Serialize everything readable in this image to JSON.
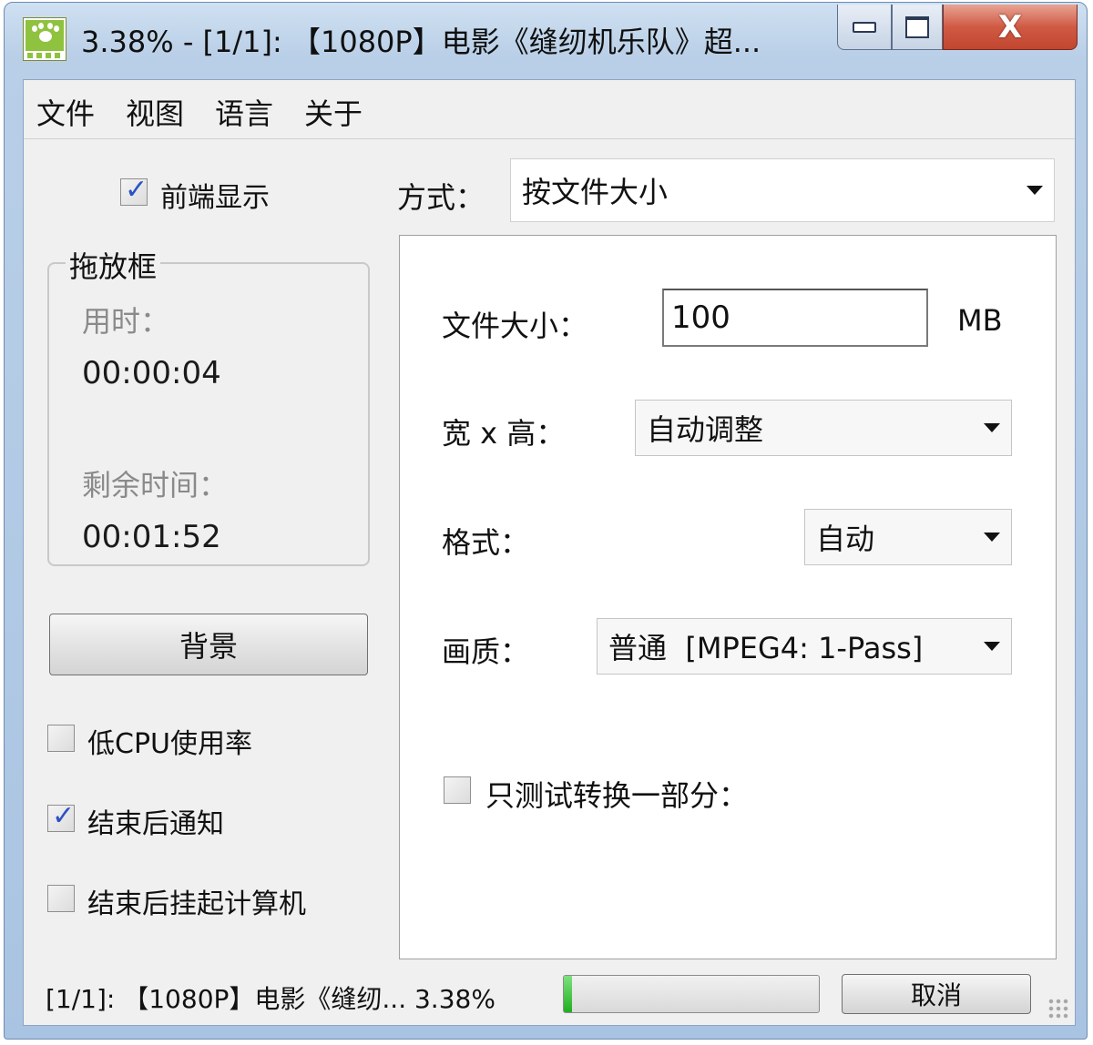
{
  "window": {
    "title": "3.38% - [1/1]: 【1080P】电影《缝纫机乐队》超...",
    "close_glyph": "X"
  },
  "menu": [
    "文件",
    "视图",
    "语言",
    "关于"
  ],
  "left": {
    "topmost_checkbox": {
      "label": "前端显示",
      "checked": true
    },
    "dropbox": {
      "title": "拖放框",
      "elapsed_label": "用时：",
      "elapsed_value": "00:00:04",
      "remaining_label": "剩余时间：",
      "remaining_value": "00:01:52"
    },
    "background_button": "背景",
    "options": [
      {
        "label": "低CPU使用率",
        "checked": false
      },
      {
        "label": "结束后通知",
        "checked": true
      },
      {
        "label": "结束后挂起计算机",
        "checked": false
      }
    ]
  },
  "mode": {
    "label": "方式：",
    "value": "按文件大小"
  },
  "settings": {
    "filesize_label": "文件大小：",
    "filesize_value": "100",
    "filesize_unit": "MB",
    "resolution_label": "宽 x 高：",
    "resolution_value": "自动调整",
    "format_label": "格式：",
    "format_value": "自动",
    "quality_label": "画质：",
    "quality_value": "普通  [MPEG4: 1-Pass]",
    "test_part_label": "只测试转换一部分：",
    "test_part_checked": false
  },
  "status": {
    "text": "[1/1]: 【1080P】电影《缝纫... 3.38%",
    "progress": 0.0338,
    "cancel_button": "取消"
  },
  "colors": {
    "check_mark": "#2a52c4",
    "progress_fill": "#1fae1f",
    "close_button": "#c24630"
  }
}
